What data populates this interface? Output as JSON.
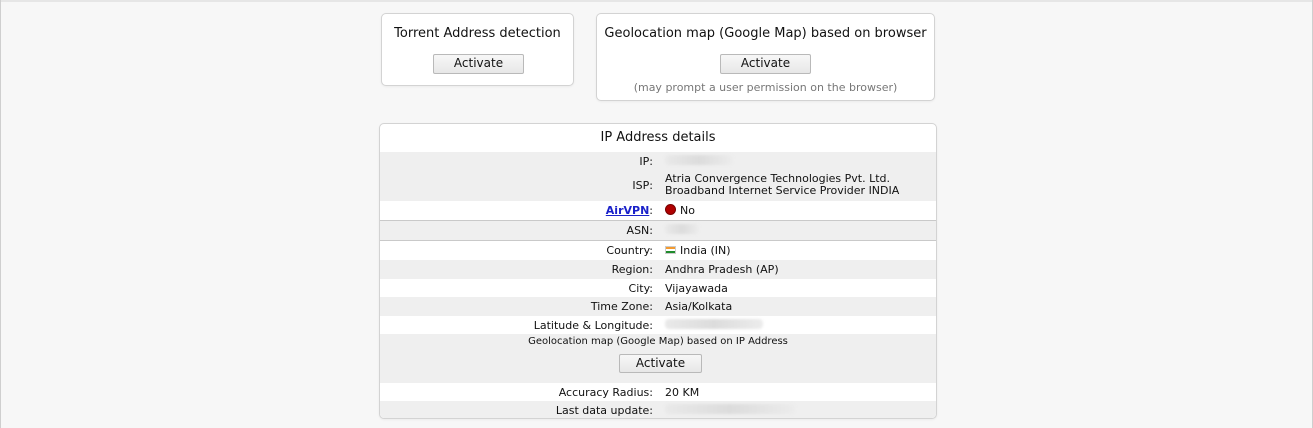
{
  "torrent_card": {
    "title": "Torrent Address detection",
    "button": "Activate"
  },
  "geo_card": {
    "title": "Geolocation map (Google Map) based on browser",
    "button": "Activate",
    "hint": "(may prompt a user permission on the browser)"
  },
  "ip_details": {
    "title": "IP Address details",
    "rows": {
      "ip": {
        "label": "IP:"
      },
      "isp": {
        "label": "ISP:",
        "value": "Atria Convergence Technologies Pvt. Ltd. Broadband Internet Service Provider INDIA"
      },
      "airvpn": {
        "link": "AirVPN",
        "colon": ":",
        "value": "No",
        "status_color": "#b00000"
      },
      "asn": {
        "label": "ASN:"
      },
      "country": {
        "label": "Country:",
        "value": "India (IN)"
      },
      "region": {
        "label": "Region:",
        "value": "Andhra Pradesh (AP)"
      },
      "city": {
        "label": "City:",
        "value": "Vijayawada"
      },
      "timezone": {
        "label": "Time Zone:",
        "value": "Asia/Kolkata"
      },
      "latlong": {
        "label": "Latitude & Longitude:"
      },
      "accuracy": {
        "label": "Accuracy Radius:",
        "value": "20 KM"
      },
      "updated": {
        "label": "Last data update:"
      }
    },
    "geo_ip": {
      "label": "Geolocation map (Google Map) based on IP Address",
      "button": "Activate"
    }
  }
}
